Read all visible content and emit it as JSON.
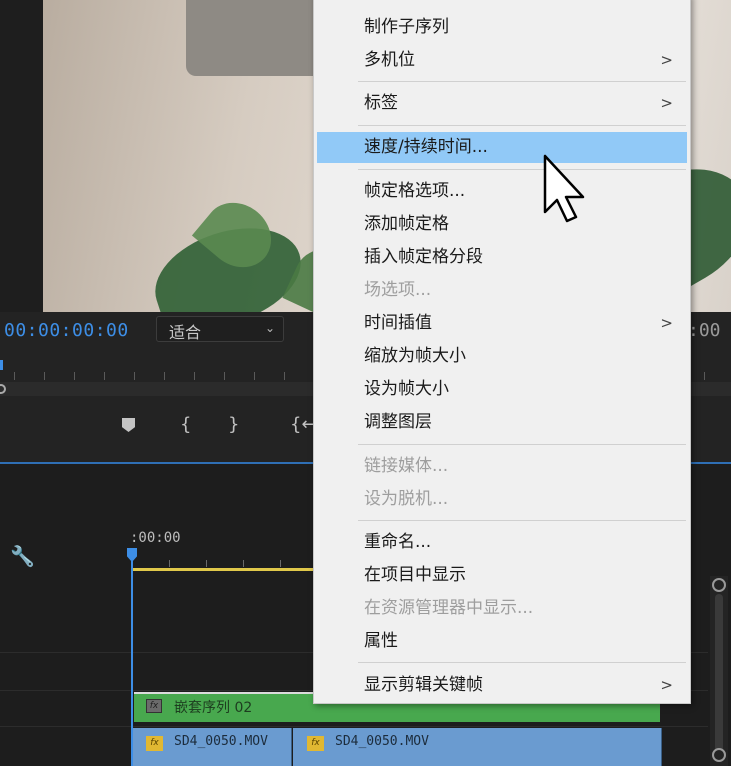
{
  "monitor": {
    "timecode": "00:00:00:00",
    "timecode_right": ":00",
    "fit_value": "适合"
  },
  "timeline": {
    "time": ":00:00",
    "clips": {
      "nested_name": "嵌套序列 02",
      "video_clip_1": "SD4_0050.MOV",
      "video_clip_2": "SD4_0050.MOV",
      "fx_label": "fx"
    }
  },
  "menu": {
    "items": [
      {
        "label": "制作子序列",
        "disabled": false
      },
      {
        "label": "多机位",
        "disabled": false,
        "submenu": true
      },
      {
        "label": "标签",
        "disabled": false,
        "submenu": true
      },
      {
        "label": "速度/持续时间...",
        "disabled": false,
        "highlighted": true
      },
      {
        "label": "帧定格选项...",
        "disabled": false
      },
      {
        "label": "添加帧定格",
        "disabled": false
      },
      {
        "label": "插入帧定格分段",
        "disabled": false
      },
      {
        "label": "场选项...",
        "disabled": true
      },
      {
        "label": "时间插值",
        "disabled": false,
        "submenu": true
      },
      {
        "label": "缩放为帧大小",
        "disabled": false
      },
      {
        "label": "设为帧大小",
        "disabled": false
      },
      {
        "label": "调整图层",
        "disabled": false
      },
      {
        "label": "链接媒体...",
        "disabled": true
      },
      {
        "label": "设为脱机...",
        "disabled": true
      },
      {
        "label": "重命名...",
        "disabled": false
      },
      {
        "label": "在项目中显示",
        "disabled": false
      },
      {
        "label": "在资源管理器中显示...",
        "disabled": true
      },
      {
        "label": "属性",
        "disabled": false
      },
      {
        "label": "显示剪辑关键帧",
        "disabled": false,
        "submenu": true
      }
    ],
    "submenu_arrow": ">"
  },
  "colors": {
    "highlight": "#91c9f7",
    "timecode_blue": "#3d8ee6",
    "nested_clip_green": "#48a84e",
    "video_clip_blue": "#6a9bd0"
  }
}
